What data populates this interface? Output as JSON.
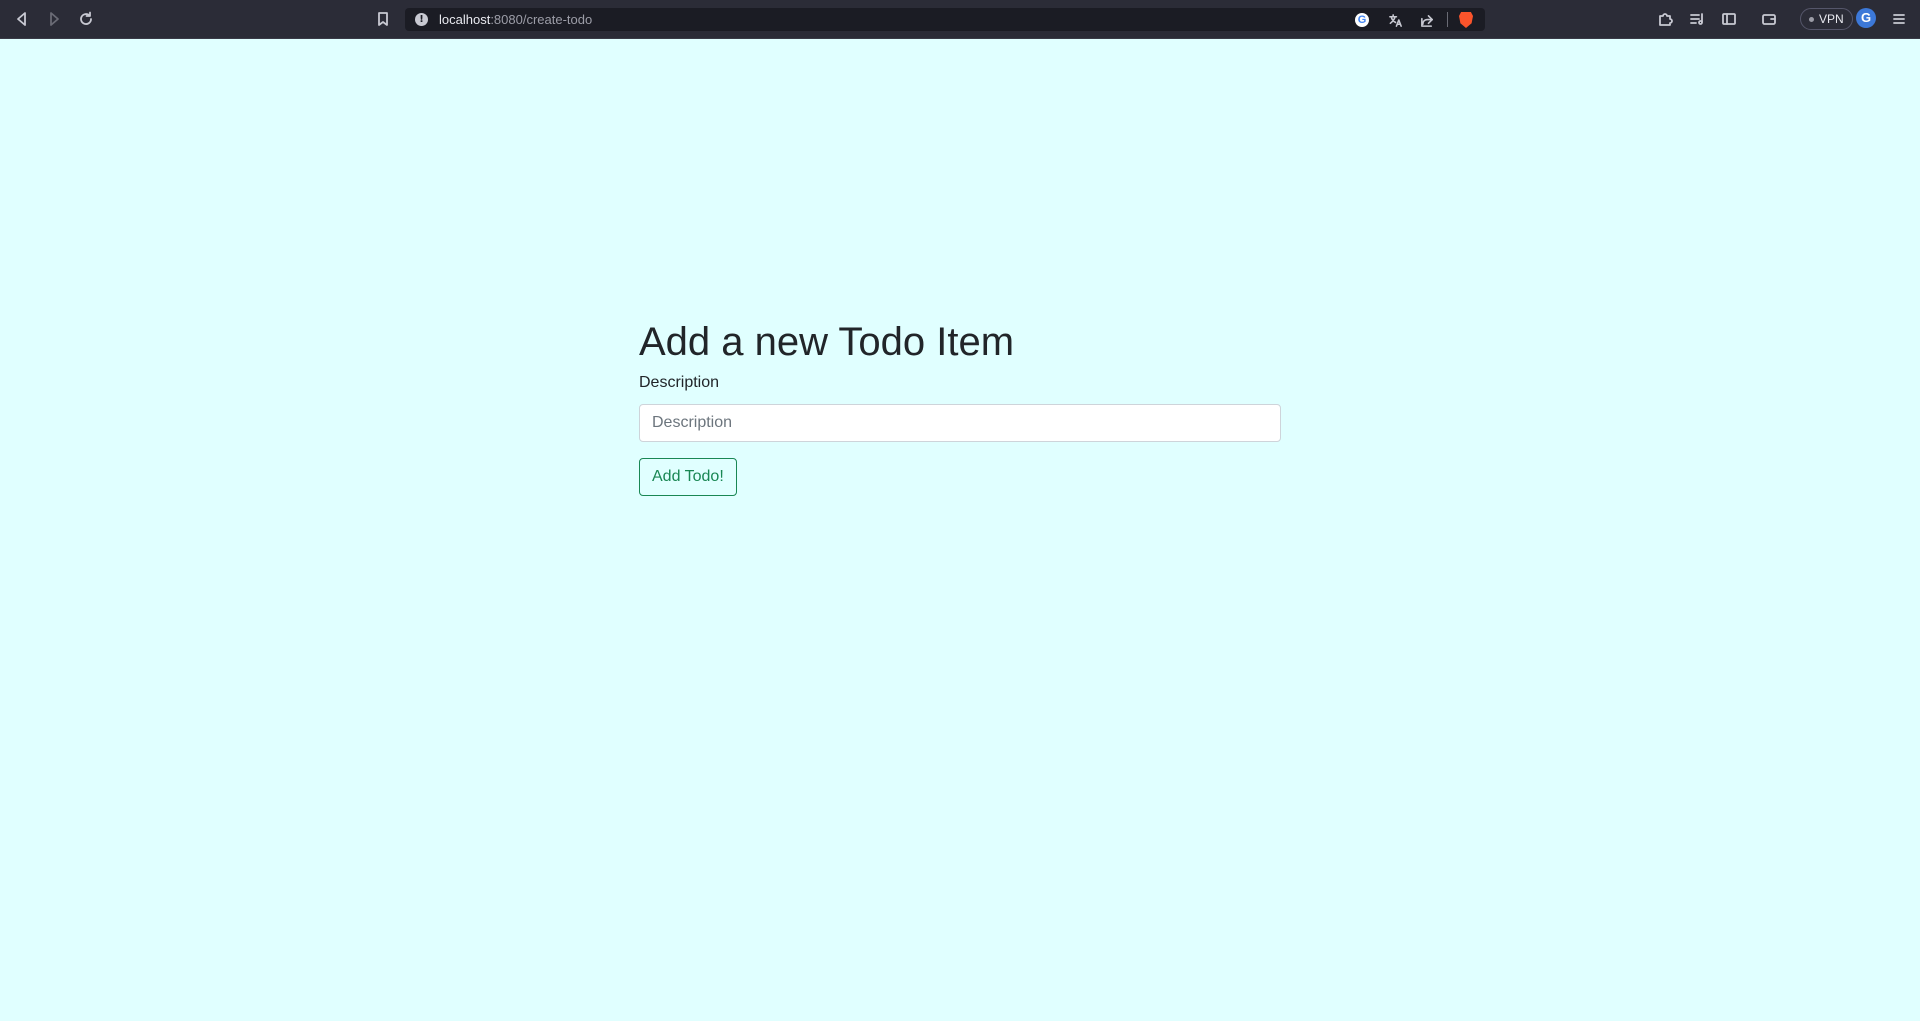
{
  "browser": {
    "url_host": "localhost",
    "url_path": ":8080/create-todo",
    "vpn_label": "VPN",
    "profile_initial": "G",
    "info_glyph": "!"
  },
  "page": {
    "title": "Add a new Todo Item",
    "description_label": "Description",
    "description_placeholder": "Description",
    "description_value": "",
    "submit_label": "Add Todo!"
  },
  "colors": {
    "page_background": "#e0ffff",
    "accent_success": "#198754",
    "browser_chrome": "#2b2c37"
  }
}
